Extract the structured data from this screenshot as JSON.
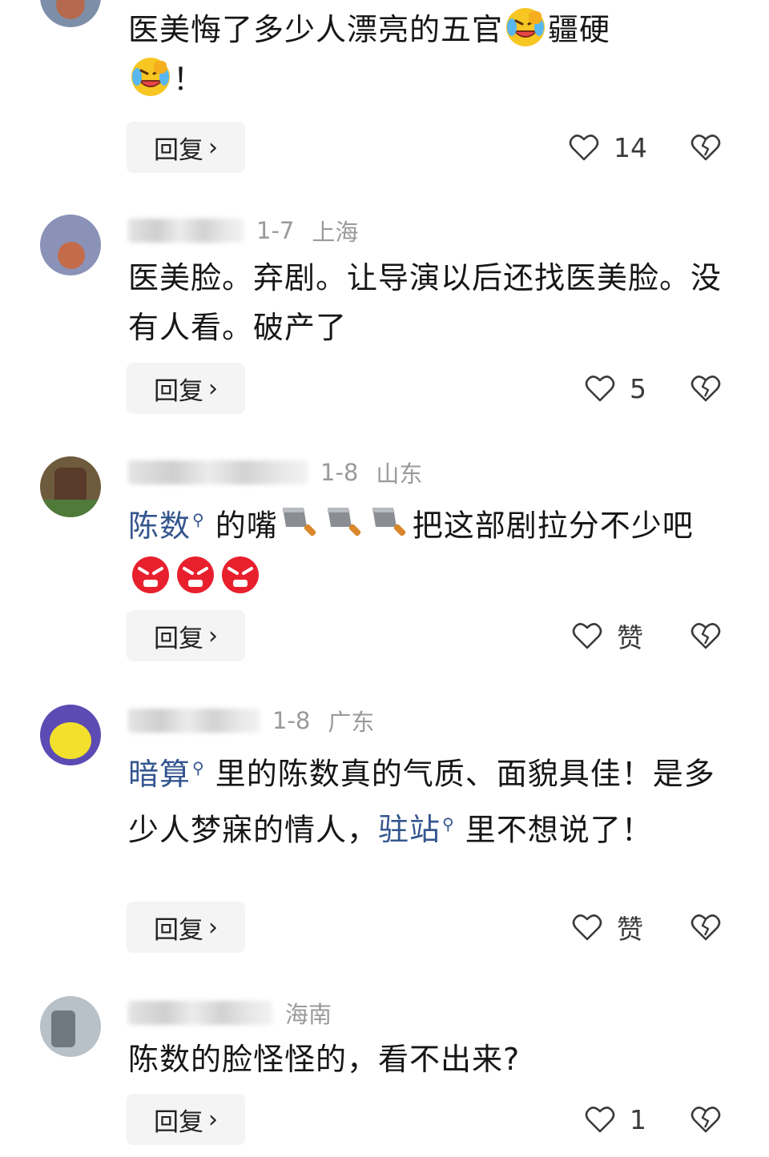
{
  "reply_label": "回复",
  "comments": [
    {
      "text_parts": [
        "医美悔了多少人漂亮的五官",
        "疆硬",
        "！"
      ],
      "likes": "14"
    },
    {
      "date": "1-7",
      "location": "上海",
      "text": "医美脸。弃剧。让导演以后还找医美脸。没有人看。破产了",
      "likes": "5"
    },
    {
      "date": "1-8",
      "location": "山东",
      "link": "陈数",
      "text_parts": [
        "的嘴",
        "把这部剧拉分不少吧"
      ],
      "likes": "赞"
    },
    {
      "date": "1-8",
      "location": "广东",
      "links": [
        "暗算",
        "驻站"
      ],
      "text_parts": [
        "里的陈数真的气质、面貌具佳！是多少人梦寐的情人，",
        "里不想说了！"
      ],
      "likes": "赞"
    },
    {
      "location": "海南",
      "text": "陈数的脸怪怪的，看不出来?",
      "likes": "1"
    }
  ],
  "icons": {
    "heart": "heart-outline-icon",
    "dislike": "broken-heart-icon",
    "search": "search-mini-icon"
  },
  "colors": {
    "link": "#34568f",
    "meta": "#9a9a9a",
    "reply_bg": "#f4f4f5"
  }
}
